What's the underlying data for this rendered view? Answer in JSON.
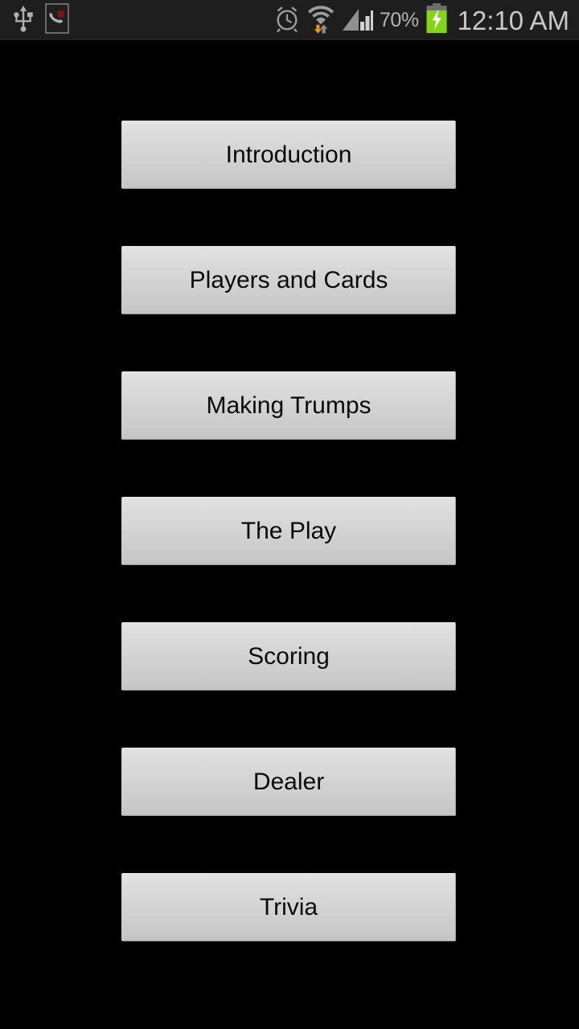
{
  "status_bar": {
    "background_color": "#1e1e1e",
    "text_color": "#c8c8c8",
    "left_icons": [
      {
        "name": "usb-icon",
        "label": "USB connected"
      },
      {
        "name": "missed-call-icon",
        "label": "Missed call"
      }
    ],
    "right_icons": [
      {
        "name": "alarm-clock-icon",
        "label": "Alarm set"
      },
      {
        "name": "wifi-icon",
        "label": "Wi-Fi connected with data activity"
      },
      {
        "name": "signal-bars-icon",
        "label": "Mobile signal"
      }
    ],
    "battery_percent": "70%",
    "battery_charging": true,
    "battery_color": "#86d514",
    "clock": "12:10 AM"
  },
  "screen": {
    "background_color": "#000000",
    "accent_color": "#ff9a20"
  },
  "menu": {
    "buttons": [
      {
        "label": "Introduction",
        "name": "menu-button-introduction"
      },
      {
        "label": "Players and Cards",
        "name": "menu-button-players-and-cards"
      },
      {
        "label": "Making Trumps",
        "name": "menu-button-making-trumps"
      },
      {
        "label": "The Play",
        "name": "menu-button-the-play"
      },
      {
        "label": "Scoring",
        "name": "menu-button-scoring"
      },
      {
        "label": "Dealer",
        "name": "menu-button-dealer"
      },
      {
        "label": "Trivia",
        "name": "menu-button-trivia"
      }
    ]
  }
}
